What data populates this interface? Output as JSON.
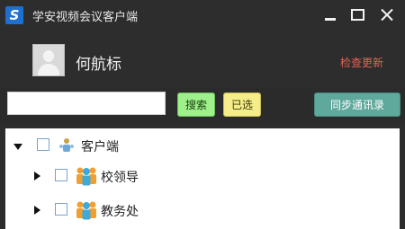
{
  "window": {
    "title": "学安视频会议客户端"
  },
  "user": {
    "name": "何航标",
    "check_update_label": "检查更新"
  },
  "search": {
    "value": "",
    "placeholder": "",
    "search_label": "搜索",
    "selected_label": "已选",
    "sync_label": "同步通讯录"
  },
  "tree": {
    "root": {
      "label": "客户端",
      "expanded": true
    },
    "children": [
      {
        "label": "校领导",
        "expanded": false
      },
      {
        "label": "教务处",
        "expanded": false
      }
    ]
  },
  "colors": {
    "background": "#2d2d2d",
    "update_link": "#e06555",
    "search_button": "#9ef08a",
    "selected_button": "#f5ed8a",
    "sync_button": "#5fa89c",
    "logo": "#1f6fd1"
  }
}
